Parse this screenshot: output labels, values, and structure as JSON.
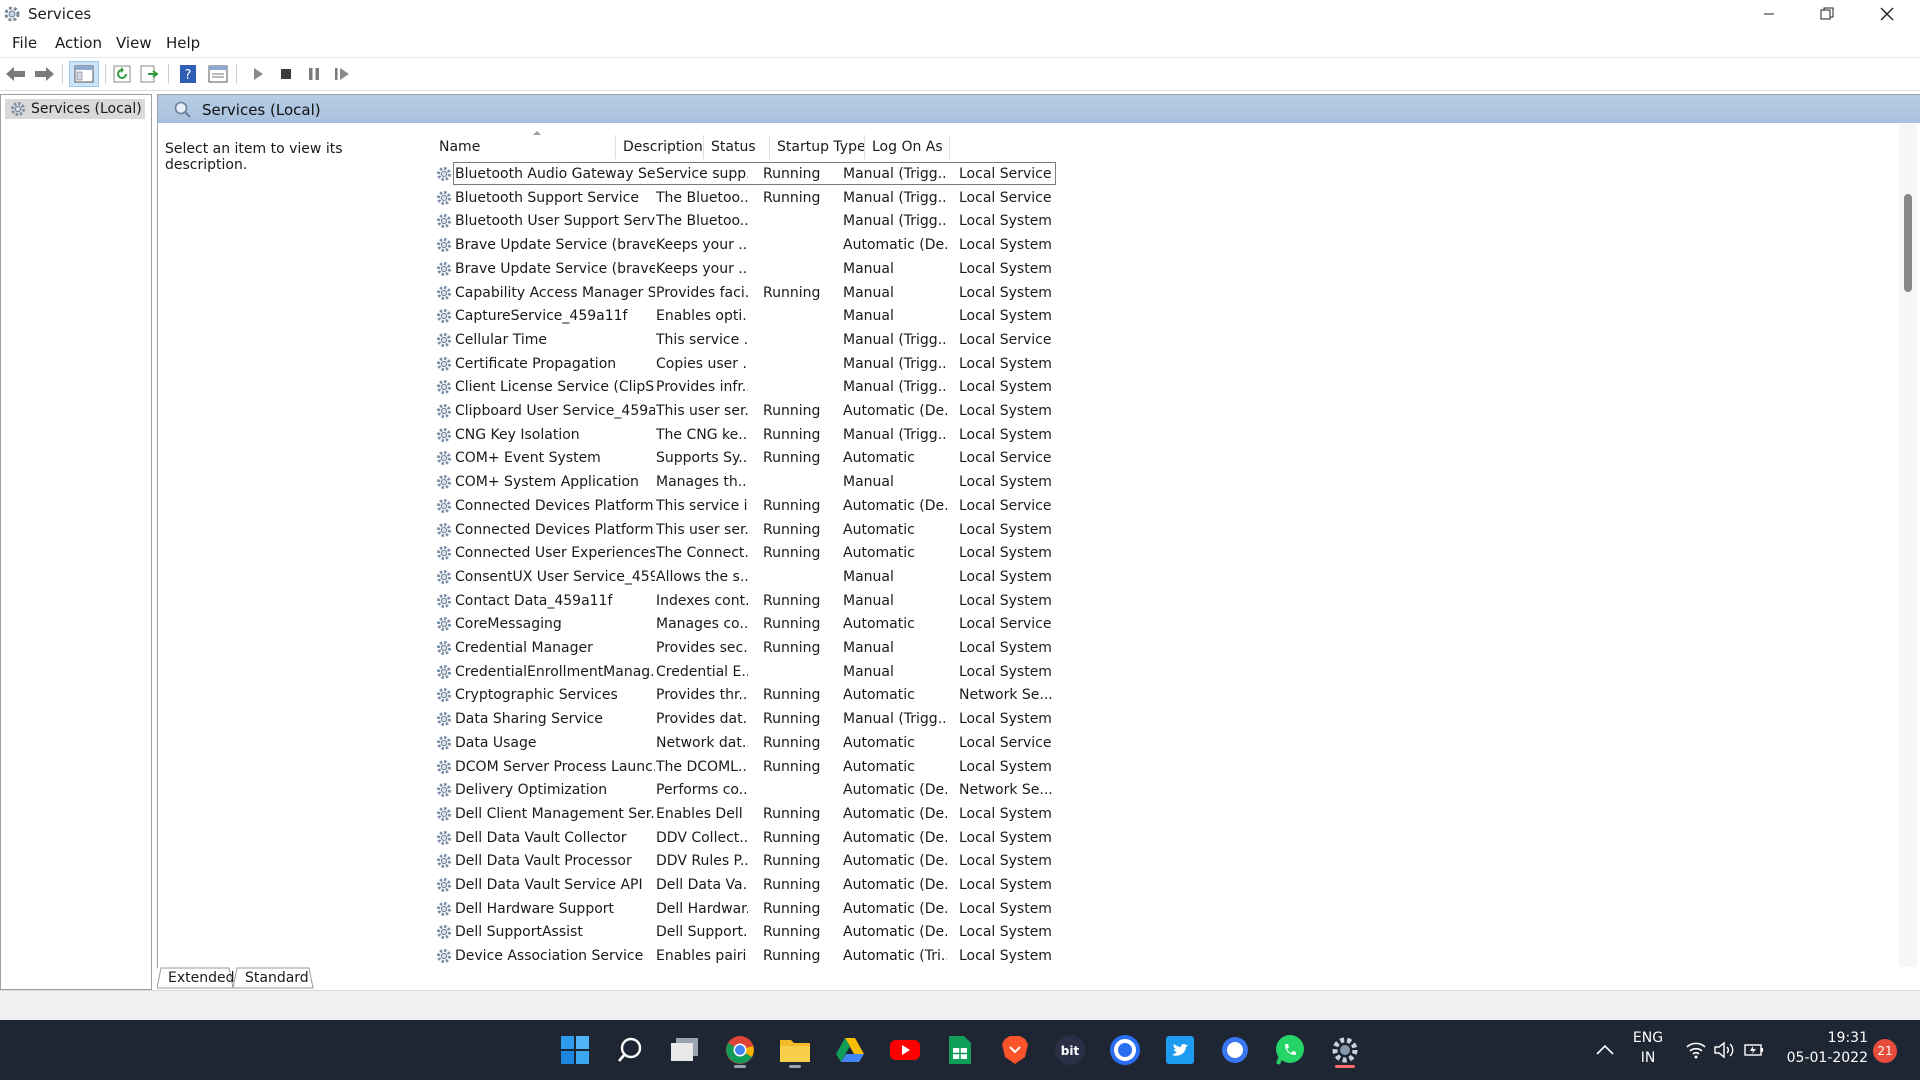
{
  "window": {
    "title": "Services"
  },
  "menu": [
    "File",
    "Action",
    "View",
    "Help"
  ],
  "tree": {
    "root_label": "Services (Local)"
  },
  "pane": {
    "header": "Services (Local)",
    "description_prompt": "Select an item to view its description."
  },
  "columns": [
    "Name",
    "Description",
    "Status",
    "Startup Type",
    "Log On As"
  ],
  "services": [
    [
      "Bluetooth Audio Gateway Se...",
      "Service supp...",
      "Running",
      "Manual (Trigg...",
      "Local Service"
    ],
    [
      "Bluetooth Support Service",
      "The Bluetoo...",
      "Running",
      "Manual (Trigg...",
      "Local Service"
    ],
    [
      "Bluetooth User Support Serv...",
      "The Bluetoo...",
      "",
      "Manual (Trigg...",
      "Local System"
    ],
    [
      "Brave Update Service (brave)",
      "Keeps your ...",
      "",
      "Automatic (De...",
      "Local System"
    ],
    [
      "Brave Update Service (brave...",
      "Keeps your ...",
      "",
      "Manual",
      "Local System"
    ],
    [
      "Capability Access Manager S...",
      "Provides faci...",
      "Running",
      "Manual",
      "Local System"
    ],
    [
      "CaptureService_459a11f",
      "Enables opti...",
      "",
      "Manual",
      "Local System"
    ],
    [
      "Cellular Time",
      "This service ...",
      "",
      "Manual (Trigg...",
      "Local Service"
    ],
    [
      "Certificate Propagation",
      "Copies user ...",
      "",
      "Manual (Trigg...",
      "Local System"
    ],
    [
      "Client License Service (ClipSV...",
      "Provides infr...",
      "",
      "Manual (Trigg...",
      "Local System"
    ],
    [
      "Clipboard User Service_459a...",
      "This user ser...",
      "Running",
      "Automatic (De...",
      "Local System"
    ],
    [
      "CNG Key Isolation",
      "The CNG ke...",
      "Running",
      "Manual (Trigg...",
      "Local System"
    ],
    [
      "COM+ Event System",
      "Supports Sy...",
      "Running",
      "Automatic",
      "Local Service"
    ],
    [
      "COM+ System Application",
      "Manages th...",
      "",
      "Manual",
      "Local System"
    ],
    [
      "Connected Devices Platform ...",
      "This service i...",
      "Running",
      "Automatic (De...",
      "Local Service"
    ],
    [
      "Connected Devices Platform ...",
      "This user ser...",
      "Running",
      "Automatic",
      "Local System"
    ],
    [
      "Connected User Experiences ...",
      "The Connect...",
      "Running",
      "Automatic",
      "Local System"
    ],
    [
      "ConsentUX User Service_459...",
      "Allows the s...",
      "",
      "Manual",
      "Local System"
    ],
    [
      "Contact Data_459a11f",
      "Indexes cont...",
      "Running",
      "Manual",
      "Local System"
    ],
    [
      "CoreMessaging",
      "Manages co...",
      "Running",
      "Automatic",
      "Local Service"
    ],
    [
      "Credential Manager",
      "Provides sec...",
      "Running",
      "Manual",
      "Local System"
    ],
    [
      "CredentialEnrollmentManag...",
      "Credential E...",
      "",
      "Manual",
      "Local System"
    ],
    [
      "Cryptographic Services",
      "Provides thr...",
      "Running",
      "Automatic",
      "Network Se..."
    ],
    [
      "Data Sharing Service",
      "Provides dat...",
      "Running",
      "Manual (Trigg...",
      "Local System"
    ],
    [
      "Data Usage",
      "Network dat...",
      "Running",
      "Automatic",
      "Local Service"
    ],
    [
      "DCOM Server Process Launc...",
      "The DCOML...",
      "Running",
      "Automatic",
      "Local System"
    ],
    [
      "Delivery Optimization",
      "Performs co...",
      "",
      "Automatic (De...",
      "Network Se..."
    ],
    [
      "Dell Client Management Ser...",
      "Enables Dell ...",
      "Running",
      "Automatic (De...",
      "Local System"
    ],
    [
      "Dell Data Vault Collector",
      "DDV Collect...",
      "Running",
      "Automatic (De...",
      "Local System"
    ],
    [
      "Dell Data Vault Processor",
      "DDV Rules P...",
      "Running",
      "Automatic (De...",
      "Local System"
    ],
    [
      "Dell Data Vault Service API",
      "Dell Data Va...",
      "Running",
      "Automatic (De...",
      "Local System"
    ],
    [
      "Dell Hardware Support",
      "Dell Hardwar...",
      "Running",
      "Automatic (De...",
      "Local System"
    ],
    [
      "Dell SupportAssist",
      "Dell Support...",
      "Running",
      "Automatic (De...",
      "Local System"
    ],
    [
      "Device Association Service",
      "Enables pairi...",
      "Running",
      "Automatic (Tri...",
      "Local System"
    ]
  ],
  "tabs": [
    "Extended",
    "Standard"
  ],
  "taskbar": {
    "apps": [
      "start-icon",
      "search-icon",
      "task-view-icon",
      "chrome-icon",
      "file-explorer-icon",
      "google-drive-icon",
      "youtube-icon",
      "google-sheets-icon",
      "brave-icon",
      "bit-icon",
      "cortana-circle-icon",
      "twitter-icon",
      "signal-icon",
      "whatsapp-icon",
      "services-gear-icon"
    ],
    "bit_label": "bit",
    "sheets_label": "⊞",
    "lang_top": "ENG",
    "lang_bottom": "IN",
    "time": "19:31",
    "date": "05-01-2022",
    "notifications": "21"
  },
  "colors": {
    "header_gradient": "#b0c7e1",
    "taskbar": "#1e2533",
    "badge": "#e74c3c"
  }
}
